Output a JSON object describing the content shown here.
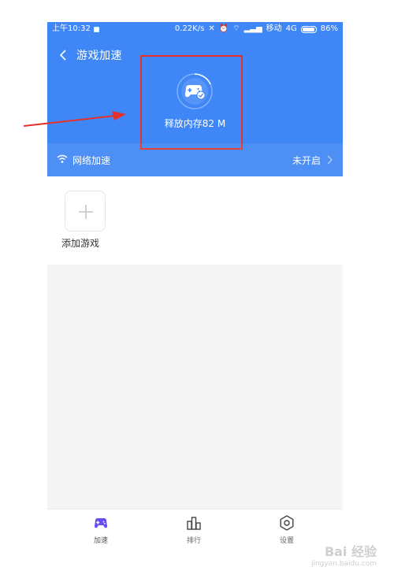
{
  "statusbar": {
    "time": "上午10:32",
    "speed": "0.22K/s",
    "carrier": "移动",
    "network": "4G",
    "battery": "86%"
  },
  "header": {
    "title": "游戏加速",
    "memory_text": "释放内存82 M"
  },
  "network_boost": {
    "label": "网络加速",
    "status": "未开启"
  },
  "games": {
    "add_label": "添加游戏"
  },
  "tabs": [
    {
      "label": "加速",
      "icon": "gamepad-icon",
      "active": true
    },
    {
      "label": "排行",
      "icon": "ranking-icon",
      "active": false
    },
    {
      "label": "设置",
      "icon": "settings-icon",
      "active": false
    }
  ],
  "watermark": {
    "text": "Bai 经验",
    "sub": "jingyan.baidu.com"
  },
  "colors": {
    "header_bg": "#3f86f6",
    "highlight_box": "#e8302a",
    "active_tab_icon": "#6b4cf0"
  }
}
